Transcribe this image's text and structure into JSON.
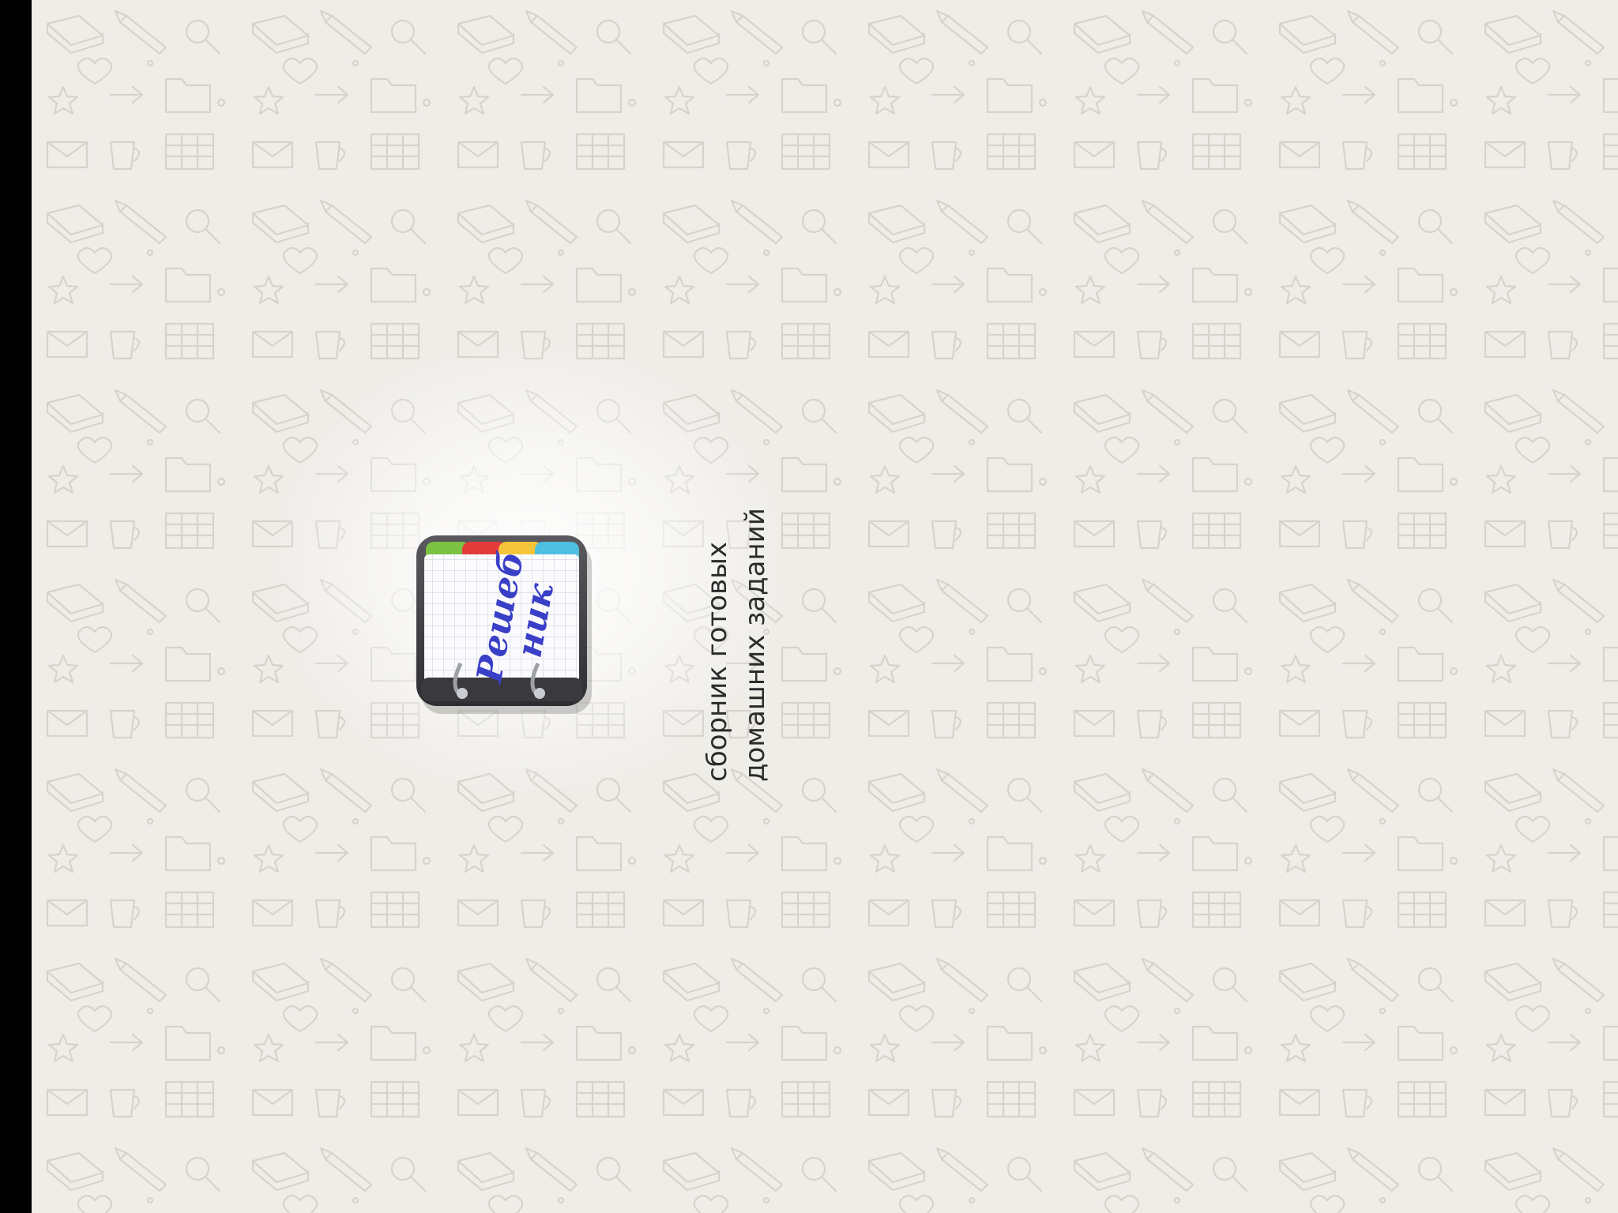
{
  "splash": {
    "app_icon": {
      "icon": "notebook-app-icon",
      "logo_text_line1": "Решеб",
      "logo_text_line2": "ник",
      "tab_colors": [
        "#7cc242",
        "#e43b3b",
        "#f4c53a",
        "#4fbfe0"
      ]
    },
    "tagline_line1": "сборник готовых",
    "tagline_line2": "домашних заданий"
  },
  "colors": {
    "background": "#efede8",
    "doodle": "#d9d6d0",
    "text": "#2b2b2b",
    "logo_ink": "#3a3fc7"
  }
}
